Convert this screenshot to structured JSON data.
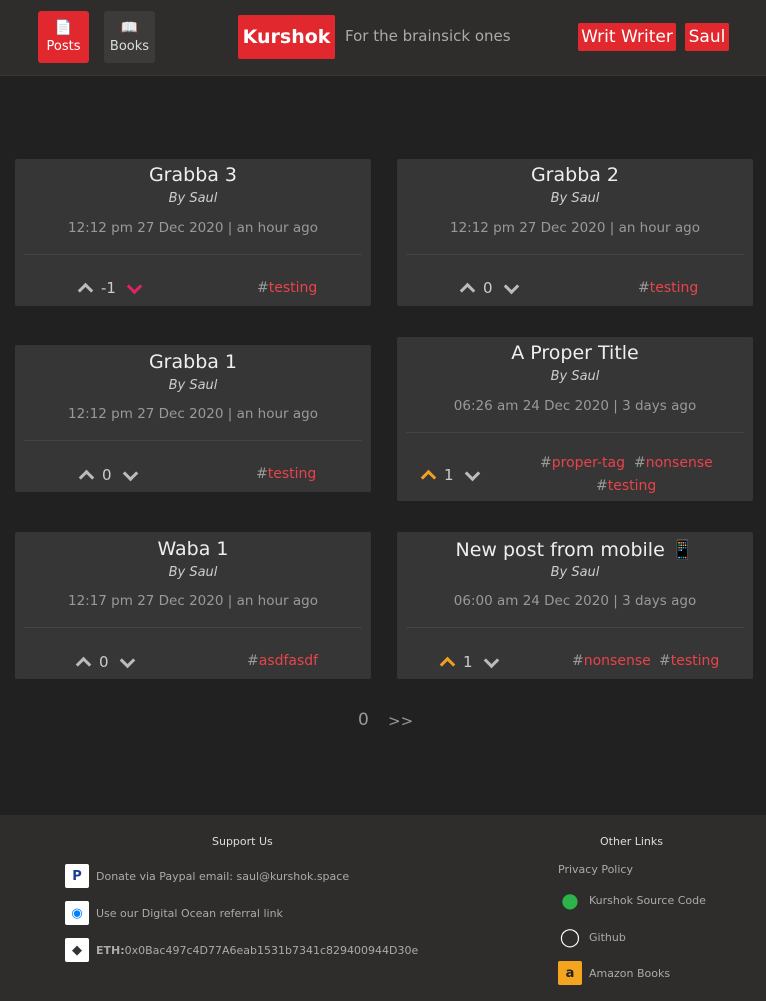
{
  "header": {
    "nav": [
      {
        "label": "Posts",
        "icon": "document-icon"
      },
      {
        "label": "Books",
        "icon": "book-icon"
      }
    ],
    "brand": "Kurshok",
    "tagline": "For the brainsick ones",
    "writer_button": "Writ Writer",
    "user_button": "Saul"
  },
  "posts": [
    {
      "title": "Grabba 3",
      "author": "By Saul",
      "date": "12:12 pm 27 Dec 2020 | an hour ago",
      "score": "-1",
      "vote": "down",
      "tags": [
        "testing"
      ]
    },
    {
      "title": "Grabba 2",
      "author": "By Saul",
      "date": "12:12 pm 27 Dec 2020 | an hour ago",
      "score": "0",
      "vote": "none",
      "tags": [
        "testing"
      ]
    },
    {
      "title": "Grabba 1",
      "author": "By Saul",
      "date": "12:12 pm 27 Dec 2020 | an hour ago",
      "score": "0",
      "vote": "none",
      "tags": [
        "testing"
      ]
    },
    {
      "title": "A Proper Title",
      "author": "By Saul",
      "date": "06:26 am 24 Dec 2020 | 3 days ago",
      "score": "1",
      "vote": "up",
      "tags": [
        "proper-tag",
        "nonsense",
        "testing"
      ]
    },
    {
      "title": "Waba 1",
      "author": "By Saul",
      "date": "12:17 pm 27 Dec 2020 | an hour ago",
      "score": "0",
      "vote": "none",
      "tags": [
        "asdfasdf"
      ]
    },
    {
      "title": "New post from mobile 📱",
      "author": "By Saul",
      "date": "06:00 am 24 Dec 2020 | 3 days ago",
      "score": "1",
      "vote": "up",
      "tags": [
        "nonsense",
        "testing"
      ]
    }
  ],
  "pagination": {
    "current": "0",
    "next": ">>"
  },
  "footer": {
    "support": {
      "heading": "Support Us",
      "paypal": "Donate via Paypal email: saul@kurshok.space",
      "digitalocean": "Use our Digital Ocean referral link",
      "eth_label": "ETH:",
      "eth_address": "0x0Bac497c4D77A6eab1531b7341c829400944D30e"
    },
    "links": {
      "heading": "Other Links",
      "privacy": "Privacy Policy",
      "source": "Kurshok Source Code",
      "github": "Github",
      "amazon": "Amazon Books"
    }
  },
  "colors": {
    "accent": "#e0282e",
    "upvote": "#f0a020",
    "downvote": "#e0245e",
    "tag": "#e8434a"
  }
}
